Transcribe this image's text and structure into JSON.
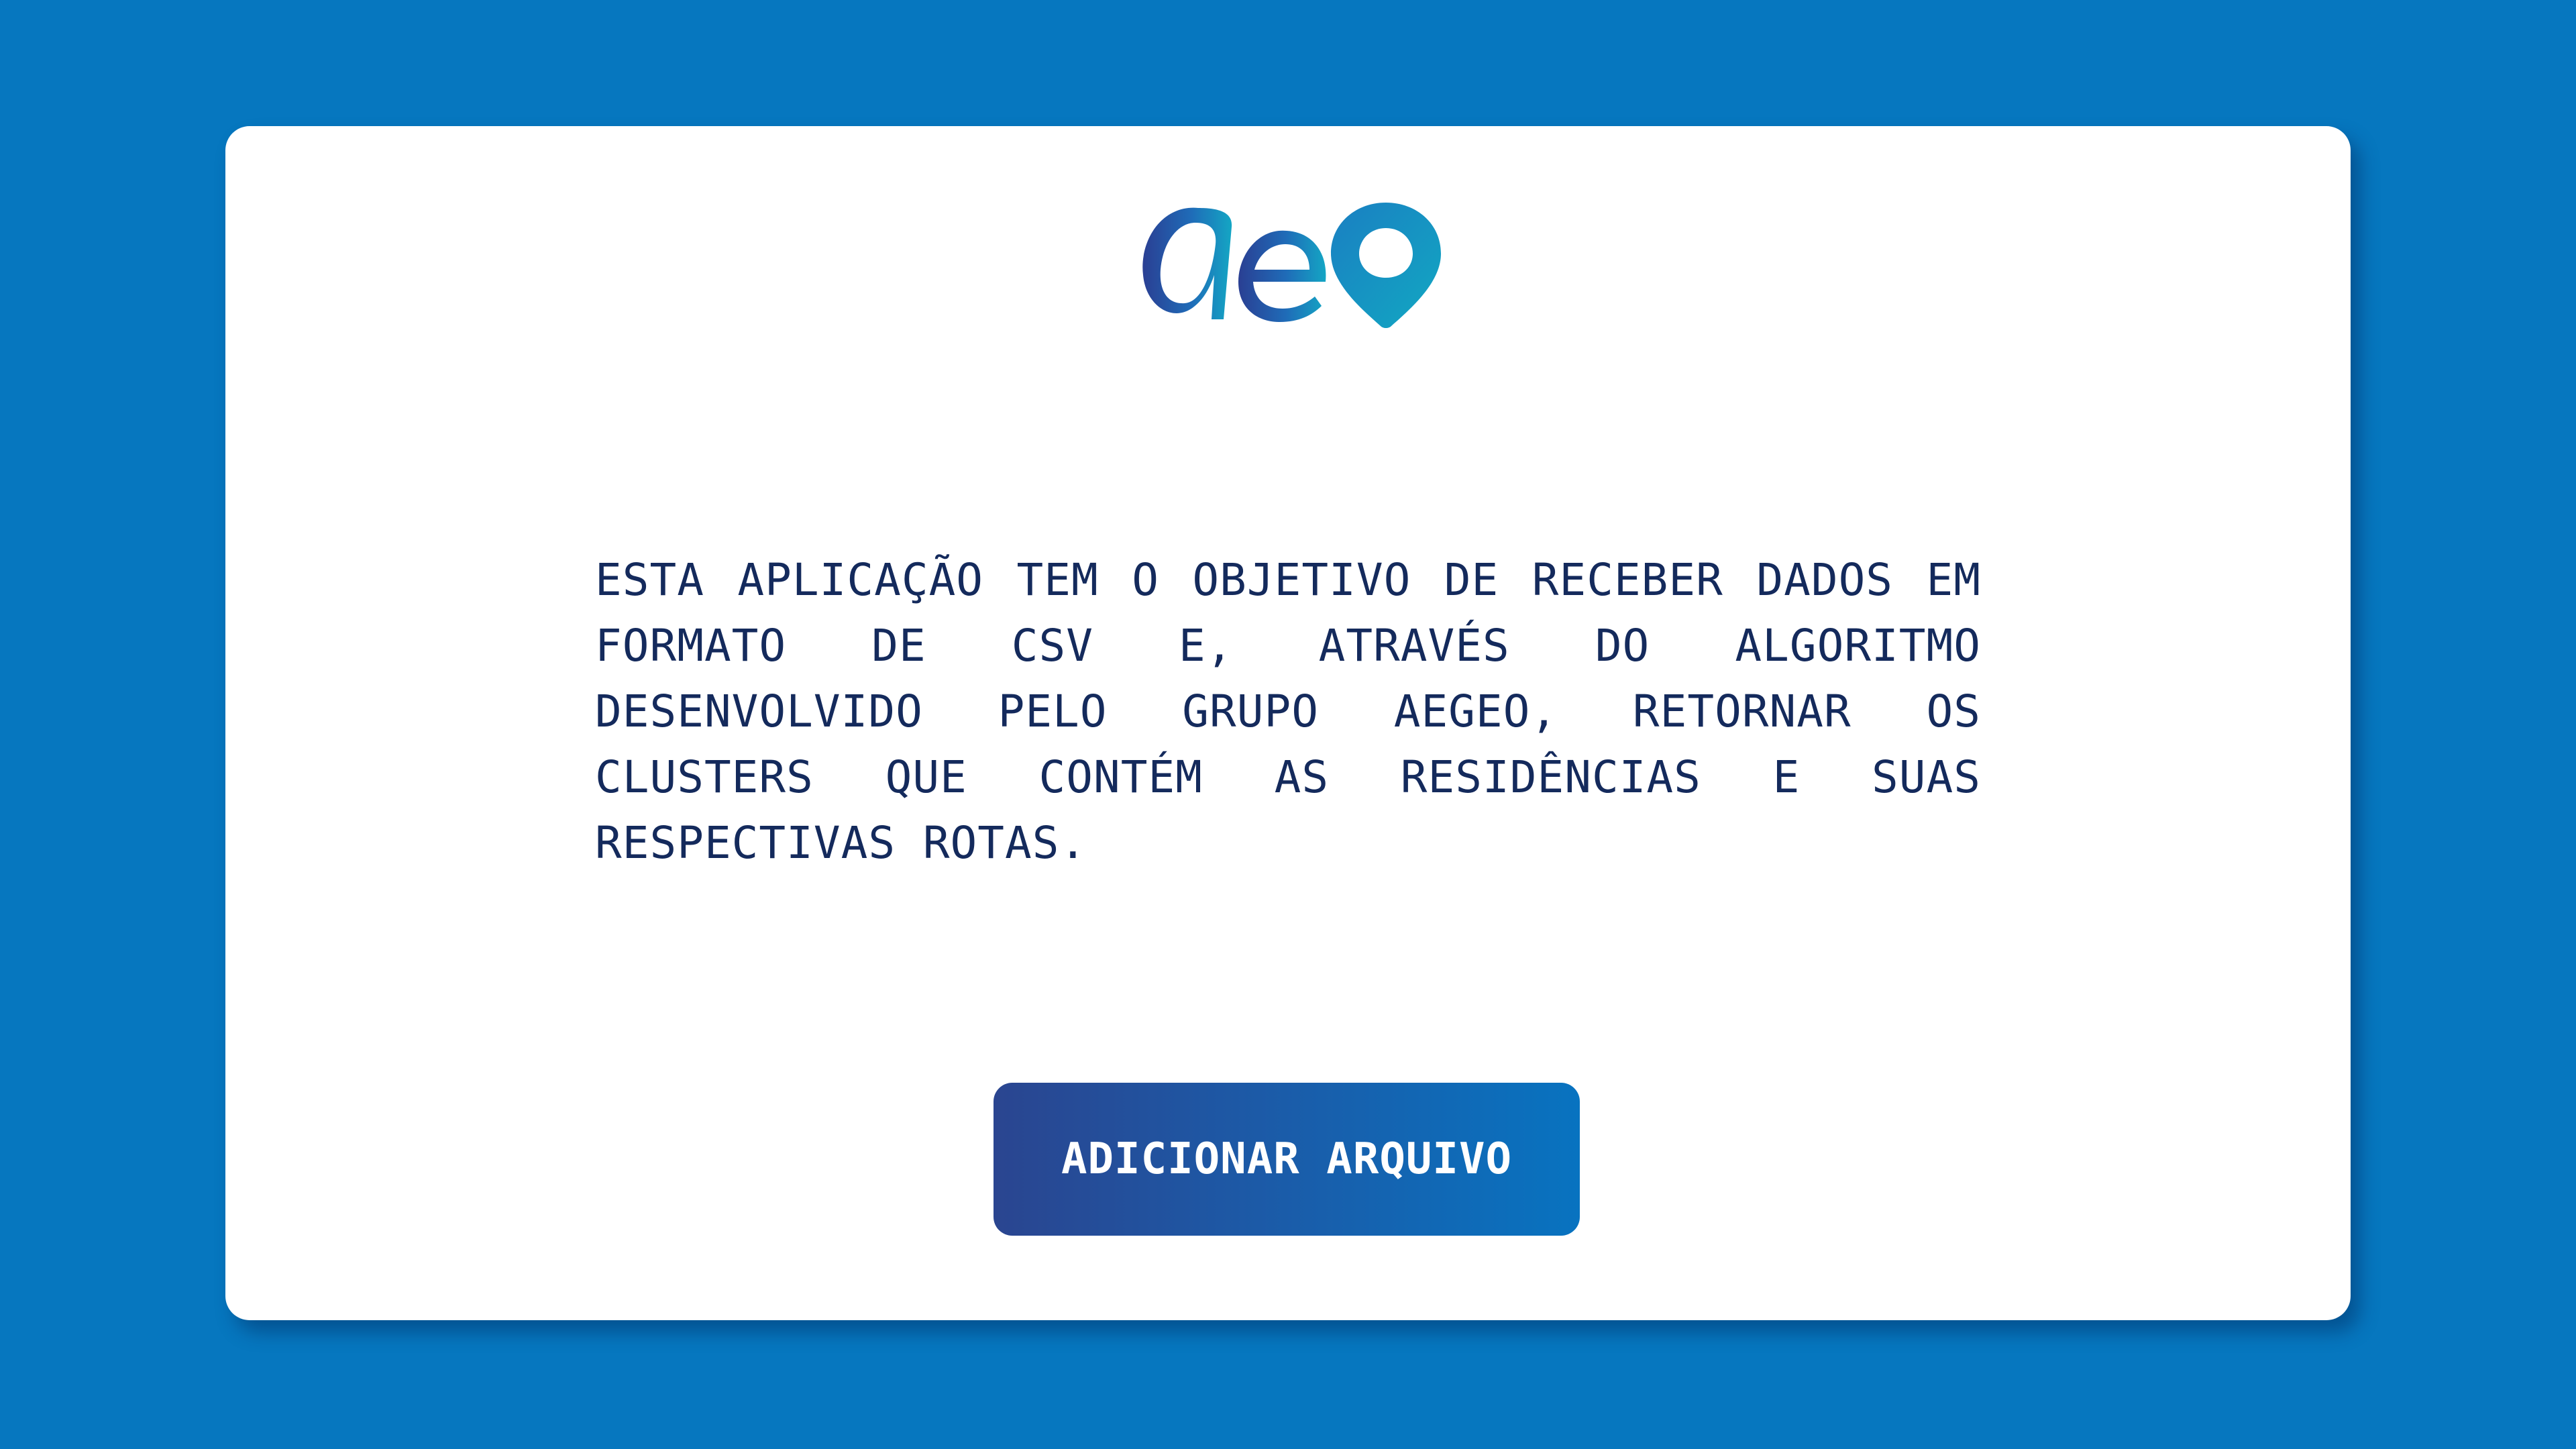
{
  "logo": {
    "text": "aeo",
    "brand_colors": [
      "#2a3f93",
      "#1f6cb8",
      "#14a6c4"
    ]
  },
  "description": {
    "text": "ESTA APLICAÇÃO TEM O OBJETIVO DE RECEBER DADOS EM FORMATO DE CSV E, ATRAVÉS DO ALGORITMO DESENVOLVIDO PELO GRUPO AEGEO, RETORNAR OS CLUSTERS QUE CONTÉM AS RESIDÊNCIAS E SUAS RESPECTIVAS ROTAS."
  },
  "upload": {
    "label": "ADICIONAR ARQUIVO"
  },
  "colors": {
    "background": "#0677bf",
    "card": "#ffffff",
    "text": "#142a5c",
    "button_gradient_start": "#2a4590",
    "button_gradient_end": "#0873c0"
  }
}
